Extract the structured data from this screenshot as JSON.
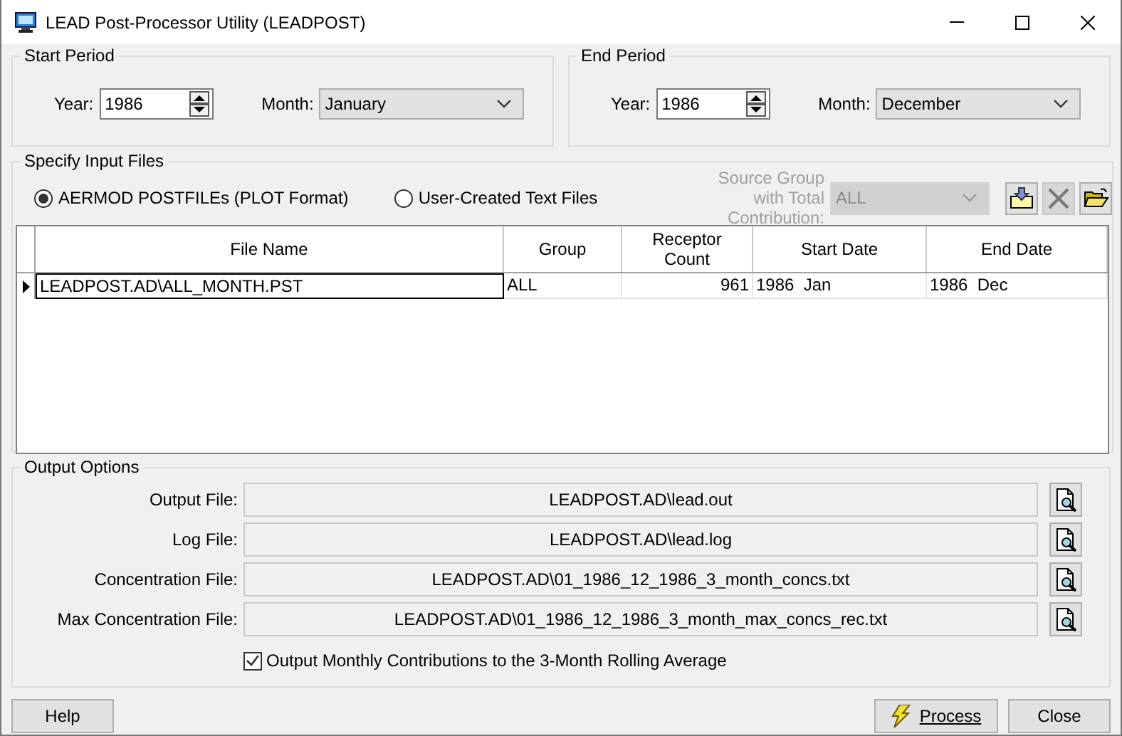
{
  "window": {
    "title": "LEAD Post-Processor Utility (LEADPOST)"
  },
  "start_period": {
    "title": "Start Period",
    "year_label": "Year:",
    "year": "1986",
    "month_label": "Month:",
    "month": "January"
  },
  "end_period": {
    "title": "End Period",
    "year_label": "Year:",
    "year": "1986",
    "month_label": "Month:",
    "month": "December"
  },
  "input_files": {
    "title": "Specify Input Files",
    "formats": [
      {
        "label": "AERMOD POSTFILEs (PLOT Format)",
        "selected": true
      },
      {
        "label": "User-Created Text Files",
        "selected": false
      }
    ],
    "source_group": {
      "label": "Source Group with Total Contribution:",
      "value": "ALL",
      "disabled": true
    },
    "table": {
      "columns": [
        "File Name",
        "Group",
        "Receptor Count",
        "Start Date",
        "End Date"
      ],
      "rows": [
        {
          "current": true,
          "cells": [
            "LEADPOST.AD\\ALL_MONTH.PST",
            "ALL",
            "961",
            "1986  Jan",
            "1986  Dec"
          ]
        }
      ]
    }
  },
  "output_options": {
    "title": "Output Options",
    "files": [
      {
        "label": "Output File:",
        "value": "LEADPOST.AD\\lead.out"
      },
      {
        "label": "Log File:",
        "value": "LEADPOST.AD\\lead.log"
      },
      {
        "label": "Concentration File:",
        "value": "LEADPOST.AD\\01_1986_12_1986_3_month_concs.txt"
      },
      {
        "label": "Max Concentration File:",
        "value": "LEADPOST.AD\\01_1986_12_1986_3_month_max_concs_rec.txt"
      }
    ],
    "monthly_contributions": {
      "label": "Output Monthly Contributions to the 3-Month Rolling Average",
      "checked": true
    }
  },
  "buttons": {
    "help": "Help",
    "process": "Process",
    "close": "Close"
  }
}
